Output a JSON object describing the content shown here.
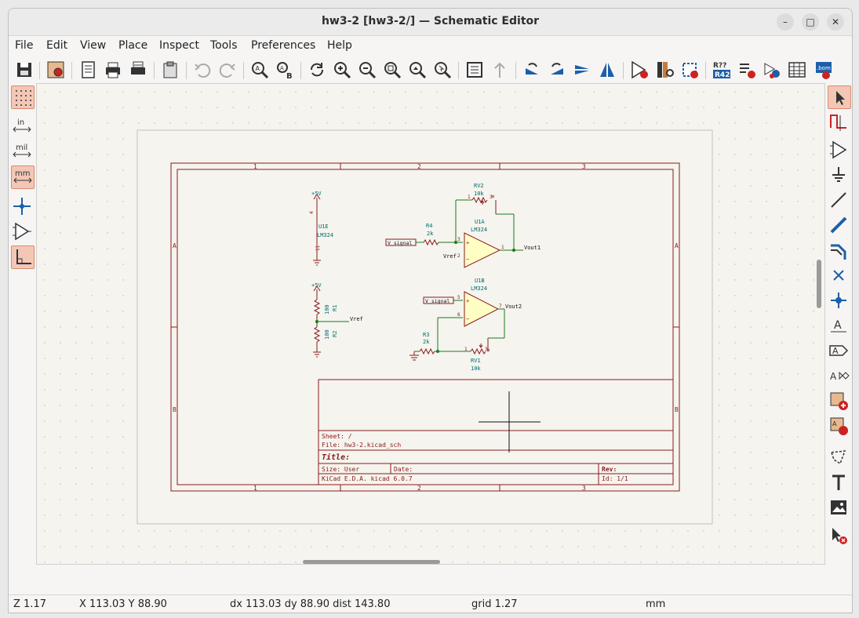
{
  "window": {
    "title": "hw3-2 [hw3-2/] — Schematic Editor",
    "minimize": "–",
    "maximize": "□",
    "close": "✕"
  },
  "menu": [
    "File",
    "Edit",
    "View",
    "Place",
    "Inspect",
    "Tools",
    "Preferences",
    "Help"
  ],
  "toolbar_icons": [
    "save-icon",
    "schematic-setup-icon",
    "page-settings-icon",
    "print-icon",
    "plot-icon",
    "paste-icon",
    "undo-icon",
    "redo-icon",
    "find-icon",
    "find-replace-icon",
    "refresh-icon",
    "zoom-in-icon",
    "zoom-out-icon",
    "zoom-fit-icon",
    "zoom-objects-icon",
    "zoom-selection-icon",
    "hierarchy-navigator-icon",
    "leave-sheet-icon",
    "rotate-ccw-icon",
    "rotate-cw-icon",
    "mirror-vertical-icon",
    "mirror-horizontal-icon",
    "symbol-editor-icon",
    "symbol-browser-icon",
    "footprint-assign-icon",
    "annotate-icon",
    "erc-icon",
    "simulator-icon",
    "bom-fields-icon",
    "bom-icon",
    "pcb-editor-icon"
  ],
  "left_tools": {
    "grid": "grid-toggle-icon",
    "in": "in",
    "mil": "mil",
    "mm": "mm",
    "cursor": "cursor-icon",
    "pins": "pin-types-icon",
    "angle": "45-degree-icon"
  },
  "right_tools": [
    "select-icon",
    "highlight-net-icon",
    "add-symbol-icon",
    "add-power-icon",
    "add-wire-icon",
    "add-bus-icon",
    "bus-entry-icon",
    "no-connect-icon",
    "junction-icon",
    "net-label-icon",
    "global-label-icon",
    "hierarchical-label-icon",
    "add-sheet-icon",
    "import-sheet-pin-icon",
    "add-line-icon",
    "add-text-icon",
    "add-image-icon",
    "delete-icon"
  ],
  "status": {
    "zoom": "Z 1.17",
    "xy": "X 113.03  Y 88.90",
    "delta": "dx 113.03  dy 88.90  dist 143.80",
    "grid": "grid 1.27",
    "units": "mm"
  },
  "schematic": {
    "columns": [
      "1",
      "2",
      "3"
    ],
    "rows": [
      "A",
      "B"
    ],
    "title_block": {
      "sheet": "Sheet: /",
      "file": "File: hw3-2.kicad_sch",
      "title": "Title:",
      "size": "Size: User",
      "date": "Date:",
      "rev": "Rev:",
      "tool": "KiCad E.D.A.  kicad 6.0.7",
      "id": "Id: 1/1"
    },
    "power_5v_top": "+5V",
    "power_5v_mid": "+5V",
    "u1e": "U1E",
    "u1e_value": "LM324",
    "u1e_pin_top": "4",
    "u1e_pin_bottom": "11",
    "rv2": "RV2",
    "rv2_value": "10k",
    "r4": "R4",
    "r4_value": "2k",
    "u1a": "U1A",
    "u1a_value": "LM324",
    "label_vsignal1": "V_signal",
    "label_vref_u1a": "Vref",
    "label_vout1": "Vout1",
    "u1b": "U1B",
    "u1b_value": "LM324",
    "label_vsignal2": "V_signal",
    "label_vout2": "Vout2",
    "r1": "R1",
    "r1_value": "100",
    "r2": "R2",
    "r2_value": "100",
    "label_vref": "Vref",
    "r3": "R3",
    "r3_value": "2k",
    "rv1": "RV1",
    "rv1_value": "10k",
    "pin1": "1",
    "pin2": "2",
    "pin3": "3",
    "pin5": "5",
    "pin6": "6",
    "pin7": "7",
    "plus": "+",
    "minus": "−"
  }
}
